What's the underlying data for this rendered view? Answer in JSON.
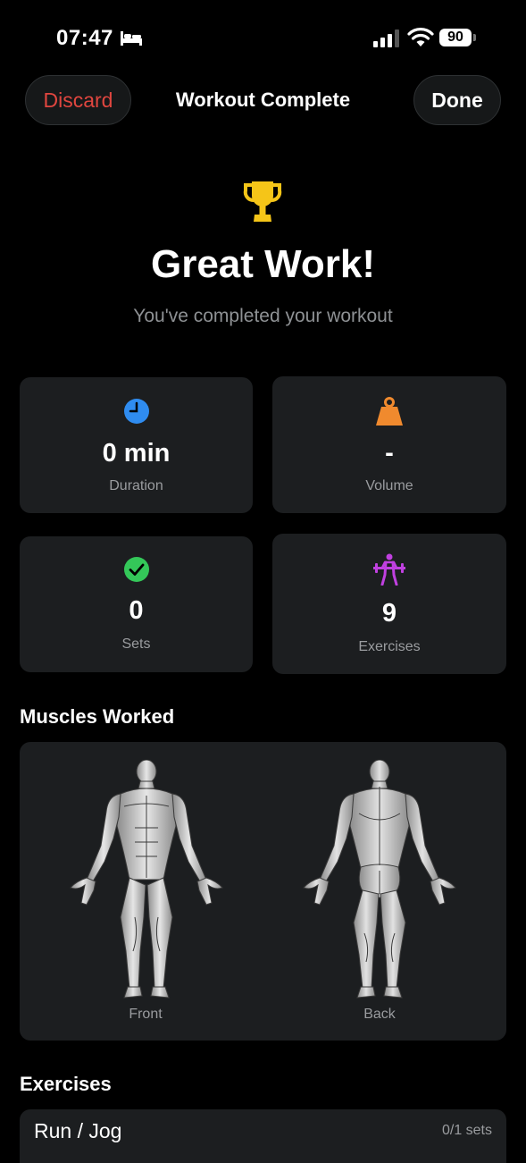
{
  "status": {
    "time": "07:47",
    "battery": "90"
  },
  "header": {
    "discard_label": "Discard",
    "title": "Workout Complete",
    "done_label": "Done"
  },
  "hero": {
    "title": "Great Work!",
    "subtitle": "You've completed your workout"
  },
  "stats": [
    {
      "icon": "clock-icon",
      "value": "0 min",
      "label": "Duration",
      "color": "#2f8cf0"
    },
    {
      "icon": "weight-icon",
      "value": "-",
      "label": "Volume",
      "color": "#f08a2e"
    },
    {
      "icon": "checkmark-icon",
      "value": "0",
      "label": "Sets",
      "color": "#34c759"
    },
    {
      "icon": "weightlifter-icon",
      "value": "9",
      "label": "Exercises",
      "color": "#c040e0"
    }
  ],
  "muscles": {
    "title": "Muscles Worked",
    "front_label": "Front",
    "back_label": "Back"
  },
  "exercises": {
    "title": "Exercises",
    "items": [
      {
        "name": "Run / Jog",
        "sets": "0/1 sets"
      }
    ]
  },
  "colors": {
    "accent_red": "#e0463f",
    "trophy": "#f5c518",
    "card_bg": "#1c1e20"
  }
}
